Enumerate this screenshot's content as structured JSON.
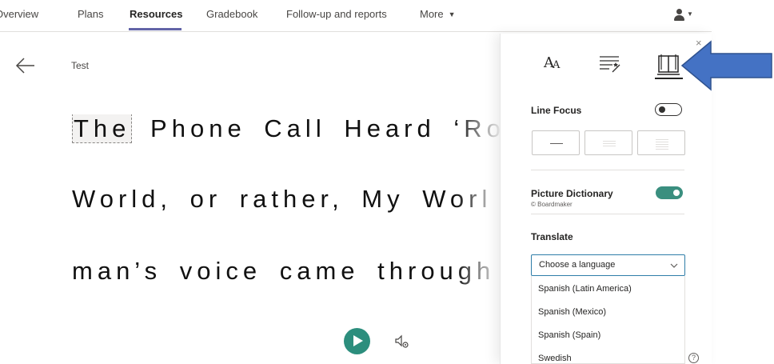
{
  "nav": {
    "tabs": [
      "Overview",
      "Plans",
      "Resources",
      "Gradebook",
      "Follow-up and reports",
      "More"
    ],
    "active_tab": "Resources"
  },
  "reader": {
    "title": "Test",
    "lines": [
      {
        "highlight": "The",
        "rest": "Phone Call Heard ‘Ro"
      },
      {
        "text": "World, or rather, My Worl"
      },
      {
        "text": "man’s voice came through"
      }
    ]
  },
  "panel": {
    "tools": [
      "text-preferences-icon",
      "grammar-options-icon",
      "reading-preferences-icon"
    ],
    "active_tool": "reading-preferences-icon",
    "line_focus": {
      "label": "Line Focus",
      "enabled": false
    },
    "picture_dictionary": {
      "label": "Picture Dictionary",
      "credit": "© Boardmaker",
      "enabled": true
    },
    "translate": {
      "label": "Translate",
      "placeholder": "Choose a language",
      "options": [
        "Spanish (Latin America)",
        "Spanish (Mexico)",
        "Spanish (Spain)",
        "Swedish"
      ]
    },
    "help": "?"
  },
  "colors": {
    "accent": "#6264a7",
    "play": "#2c8e7d",
    "toggle_on": "#3a8f7f",
    "select_border": "#2f7da8",
    "annotation_arrow": "#4472c4"
  }
}
